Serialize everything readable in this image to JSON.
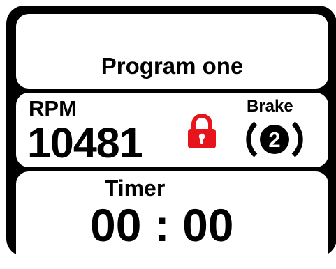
{
  "title_panel": {
    "program_name": "Program one"
  },
  "status_panel": {
    "rpm_label": "RPM",
    "rpm_value": "10481",
    "lock_icon": "lock-closed",
    "brake_label": "Brake",
    "brake_level": "2",
    "brake_icon": "brake-warning-circle"
  },
  "timer_panel": {
    "timer_label": "Timer",
    "timer_value": "00 : 00"
  },
  "colors": {
    "frame": "#000000",
    "panel": "#ffffff",
    "text": "#000000",
    "lock": "#e8141b"
  }
}
